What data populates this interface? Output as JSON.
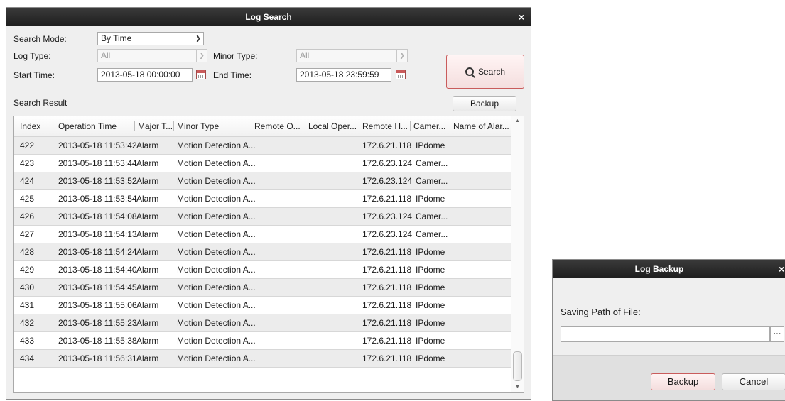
{
  "log_search": {
    "title": "Log Search",
    "close": "×",
    "search_mode_label": "Search Mode:",
    "search_mode_value": "By Time",
    "log_type_label": "Log Type:",
    "log_type_value": "All",
    "minor_type_label": "Minor Type:",
    "minor_type_value": "All",
    "start_time_label": "Start Time:",
    "start_time_value": "2013-05-18 00:00:00",
    "end_time_label": "End Time:",
    "end_time_value": "2013-05-18 23:59:59",
    "search_button": "Search",
    "search_result_label": "Search Result",
    "backup_button": "Backup",
    "columns": [
      "Index",
      "Operation Time",
      "Major T...",
      "Minor Type",
      "Remote O...",
      "Local Oper...",
      "Remote H...",
      "Camer...",
      "Name of Alar..."
    ],
    "rows": [
      {
        "index": "422",
        "time": "2013-05-18 11:53:42",
        "major": "Alarm",
        "minor": "Motion Detection A...",
        "remote_op": "",
        "local_op": "",
        "remote_host": "172.6.21.118",
        "camera": "IPdome",
        "alarm_name": ""
      },
      {
        "index": "423",
        "time": "2013-05-18 11:53:44",
        "major": "Alarm",
        "minor": "Motion Detection A...",
        "remote_op": "",
        "local_op": "",
        "remote_host": "172.6.23.124",
        "camera": "Camer...",
        "alarm_name": ""
      },
      {
        "index": "424",
        "time": "2013-05-18 11:53:52",
        "major": "Alarm",
        "minor": "Motion Detection A...",
        "remote_op": "",
        "local_op": "",
        "remote_host": "172.6.23.124",
        "camera": "Camer...",
        "alarm_name": ""
      },
      {
        "index": "425",
        "time": "2013-05-18 11:53:54",
        "major": "Alarm",
        "minor": "Motion Detection A...",
        "remote_op": "",
        "local_op": "",
        "remote_host": "172.6.21.118",
        "camera": "IPdome",
        "alarm_name": ""
      },
      {
        "index": "426",
        "time": "2013-05-18 11:54:08",
        "major": "Alarm",
        "minor": "Motion Detection A...",
        "remote_op": "",
        "local_op": "",
        "remote_host": "172.6.23.124",
        "camera": "Camer...",
        "alarm_name": ""
      },
      {
        "index": "427",
        "time": "2013-05-18 11:54:13",
        "major": "Alarm",
        "minor": "Motion Detection A...",
        "remote_op": "",
        "local_op": "",
        "remote_host": "172.6.23.124",
        "camera": "Camer...",
        "alarm_name": ""
      },
      {
        "index": "428",
        "time": "2013-05-18 11:54:24",
        "major": "Alarm",
        "minor": "Motion Detection A...",
        "remote_op": "",
        "local_op": "",
        "remote_host": "172.6.21.118",
        "camera": "IPdome",
        "alarm_name": ""
      },
      {
        "index": "429",
        "time": "2013-05-18 11:54:40",
        "major": "Alarm",
        "minor": "Motion Detection A...",
        "remote_op": "",
        "local_op": "",
        "remote_host": "172.6.21.118",
        "camera": "IPdome",
        "alarm_name": ""
      },
      {
        "index": "430",
        "time": "2013-05-18 11:54:45",
        "major": "Alarm",
        "minor": "Motion Detection A...",
        "remote_op": "",
        "local_op": "",
        "remote_host": "172.6.21.118",
        "camera": "IPdome",
        "alarm_name": ""
      },
      {
        "index": "431",
        "time": "2013-05-18 11:55:06",
        "major": "Alarm",
        "minor": "Motion Detection A...",
        "remote_op": "",
        "local_op": "",
        "remote_host": "172.6.21.118",
        "camera": "IPdome",
        "alarm_name": ""
      },
      {
        "index": "432",
        "time": "2013-05-18 11:55:23",
        "major": "Alarm",
        "minor": "Motion Detection A...",
        "remote_op": "",
        "local_op": "",
        "remote_host": "172.6.21.118",
        "camera": "IPdome",
        "alarm_name": ""
      },
      {
        "index": "433",
        "time": "2013-05-18 11:55:38",
        "major": "Alarm",
        "minor": "Motion Detection A...",
        "remote_op": "",
        "local_op": "",
        "remote_host": "172.6.21.118",
        "camera": "IPdome",
        "alarm_name": ""
      },
      {
        "index": "434",
        "time": "2013-05-18 11:56:31",
        "major": "Alarm",
        "minor": "Motion Detection A...",
        "remote_op": "",
        "local_op": "",
        "remote_host": "172.6.21.118",
        "camera": "IPdome",
        "alarm_name": ""
      }
    ]
  },
  "log_backup": {
    "title": "Log Backup",
    "close": "×",
    "saving_path_label": "Saving Path of File:",
    "saving_path_value": "",
    "browse_button": "···",
    "backup_button": "Backup",
    "cancel_button": "Cancel"
  },
  "icons": {
    "dropdown": "chevron-down-icon",
    "calendar": "calendar-icon",
    "search": "search-icon",
    "close": "close-icon"
  },
  "colors": {
    "titlebar": "#1e1e1e",
    "window_bg": "#efefef",
    "row_alt": "#ececec",
    "accent_border": "#c95c5c"
  }
}
